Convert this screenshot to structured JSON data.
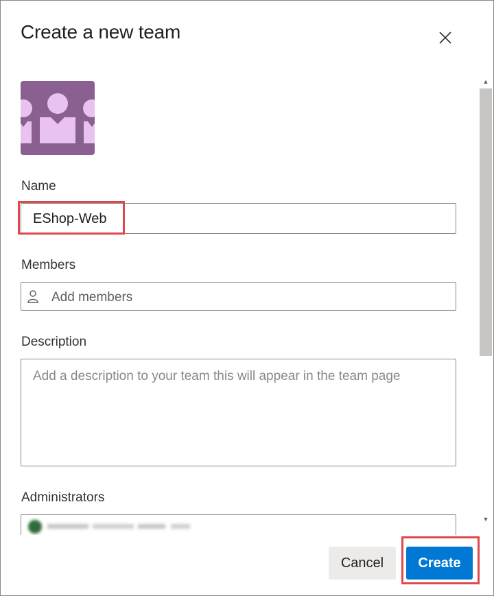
{
  "dialog": {
    "title": "Create a new team",
    "close_icon": "close-icon"
  },
  "team_image": {
    "icon": "team-avatar-icon",
    "background": "#8a6090",
    "figure_color": "#e8c3ef"
  },
  "name": {
    "label": "Name",
    "value": "EShop-Web"
  },
  "members": {
    "label": "Members",
    "placeholder": "Add members",
    "icon": "person-icon"
  },
  "description": {
    "label": "Description",
    "placeholder": "Add a description to your team this will appear in the team page"
  },
  "administrators": {
    "label": "Administrators",
    "avatar_color": "#2e6b3a"
  },
  "footer": {
    "cancel_label": "Cancel",
    "create_label": "Create"
  },
  "colors": {
    "primary": "#0078d4",
    "highlight": "#e0474c",
    "border": "#8a8886"
  }
}
